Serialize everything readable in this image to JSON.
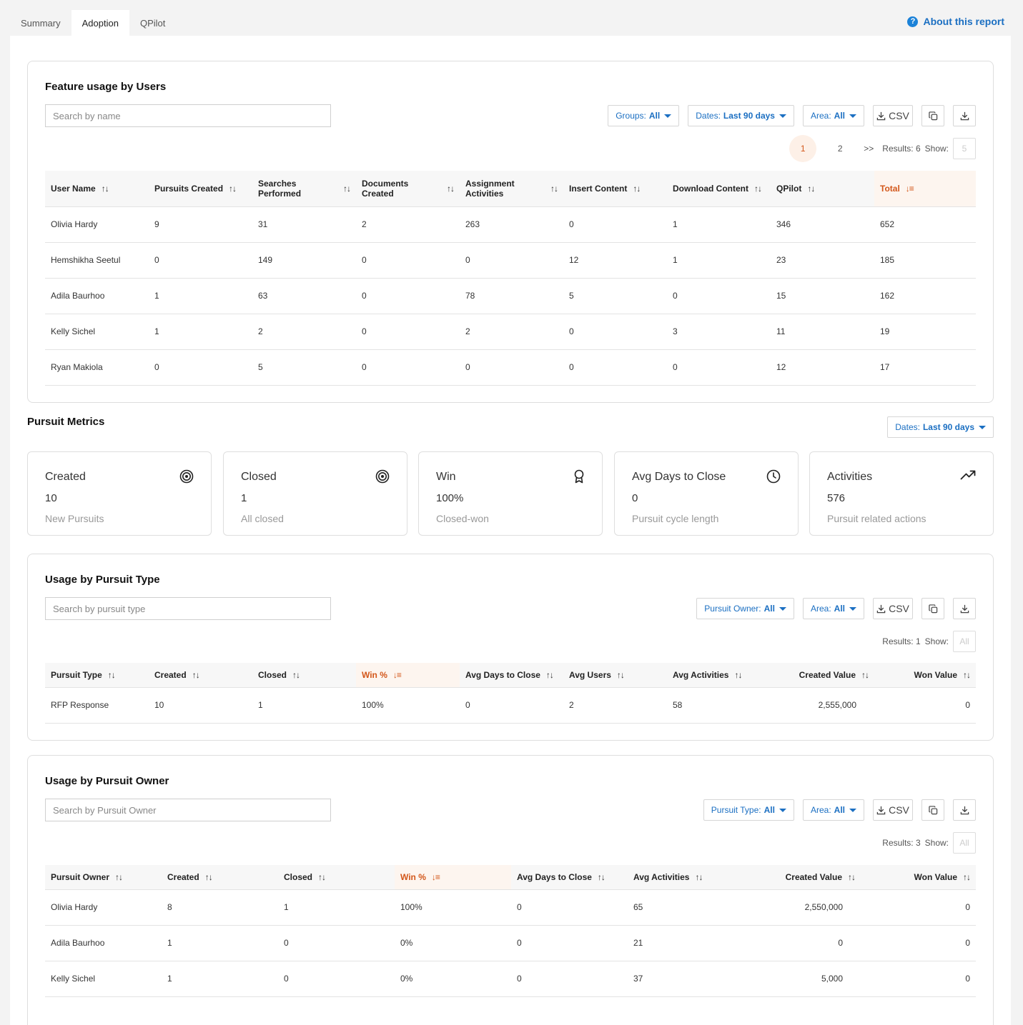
{
  "tabs": [
    "Summary",
    "Adoption",
    "QPilot"
  ],
  "about_label": "About this report",
  "feature": {
    "title": "Feature usage by Users",
    "search_placeholder": "Search by name",
    "filters": [
      {
        "label": "Groups:",
        "value": "All"
      },
      {
        "label": "Dates:",
        "value": "Last 90 days"
      },
      {
        "label": "Area:",
        "value": "All"
      }
    ],
    "csv_label": "CSV",
    "pages": [
      "1",
      "2",
      ">>"
    ],
    "results_label": "Results: 6",
    "show_label": "Show:",
    "show_value": "5",
    "columns": [
      "User Name",
      "Pursuits Created",
      "Searches Performed",
      "Documents Created",
      "Assignment Activities",
      "Insert Content",
      "Download Content",
      "QPilot",
      "Total"
    ],
    "rows": [
      [
        "Olivia Hardy",
        "9",
        "31",
        "2",
        "263",
        "0",
        "1",
        "346",
        "652"
      ],
      [
        "Hemshikha Seetul",
        "0",
        "149",
        "0",
        "0",
        "12",
        "1",
        "23",
        "185"
      ],
      [
        "Adila Baurhoo",
        "1",
        "63",
        "0",
        "78",
        "5",
        "0",
        "15",
        "162"
      ],
      [
        "Kelly Sichel",
        "1",
        "2",
        "0",
        "2",
        "0",
        "3",
        "11",
        "19"
      ],
      [
        "Ryan Makiola",
        "0",
        "5",
        "0",
        "0",
        "0",
        "0",
        "12",
        "17"
      ]
    ]
  },
  "metrics": {
    "title": "Pursuit Metrics",
    "dates_label": "Dates:",
    "dates_value": "Last 90 days",
    "cards": [
      {
        "label": "Created",
        "value": "10",
        "sub": "New Pursuits",
        "icon": "target-icon"
      },
      {
        "label": "Closed",
        "value": "1",
        "sub": "All closed",
        "icon": "target-icon"
      },
      {
        "label": "Win",
        "value": "100%",
        "sub": "Closed-won",
        "icon": "award-icon"
      },
      {
        "label": "Avg Days to Close",
        "value": "0",
        "sub": "Pursuit cycle length",
        "icon": "clock-icon"
      },
      {
        "label": "Activities",
        "value": "576",
        "sub": "Pursuit related actions",
        "icon": "trending-up-icon"
      }
    ]
  },
  "type_usage": {
    "title": "Usage by Pursuit Type",
    "search_placeholder": "Search by pursuit type",
    "filters": [
      {
        "label": "Pursuit Owner:",
        "value": "All"
      },
      {
        "label": "Area:",
        "value": "All"
      }
    ],
    "csv_label": "CSV",
    "results_label": "Results: 1",
    "show_label": "Show:",
    "show_value": "All",
    "columns": [
      "Pursuit Type",
      "Created",
      "Closed",
      "Win %",
      "Avg Days to Close",
      "Avg Users",
      "Avg Activities",
      "Created Value",
      "Won Value"
    ],
    "rows": [
      [
        "RFP Response",
        "10",
        "1",
        "100%",
        "0",
        "2",
        "58",
        "2,555,000",
        "0"
      ]
    ]
  },
  "owner_usage": {
    "title": "Usage by Pursuit Owner",
    "search_placeholder": "Search by Pursuit Owner",
    "filters": [
      {
        "label": "Pursuit Type:",
        "value": "All"
      },
      {
        "label": "Area:",
        "value": "All"
      }
    ],
    "csv_label": "CSV",
    "results_label": "Results: 3",
    "show_label": "Show:",
    "show_value": "All",
    "columns": [
      "Pursuit Owner",
      "Created",
      "Closed",
      "Win %",
      "Avg Days to Close",
      "Avg Activities",
      "Created Value",
      "Won Value"
    ],
    "rows": [
      [
        "Olivia Hardy",
        "8",
        "1",
        "100%",
        "0",
        "65",
        "2,550,000",
        "0"
      ],
      [
        "Adila Baurhoo",
        "1",
        "0",
        "0%",
        "0",
        "21",
        "0",
        "0"
      ],
      [
        "Kelly Sichel",
        "1",
        "0",
        "0%",
        "0",
        "37",
        "5,000",
        "0"
      ]
    ]
  },
  "colors": {
    "accent": "#1b6fc2",
    "active_sort": "#d3571a"
  }
}
